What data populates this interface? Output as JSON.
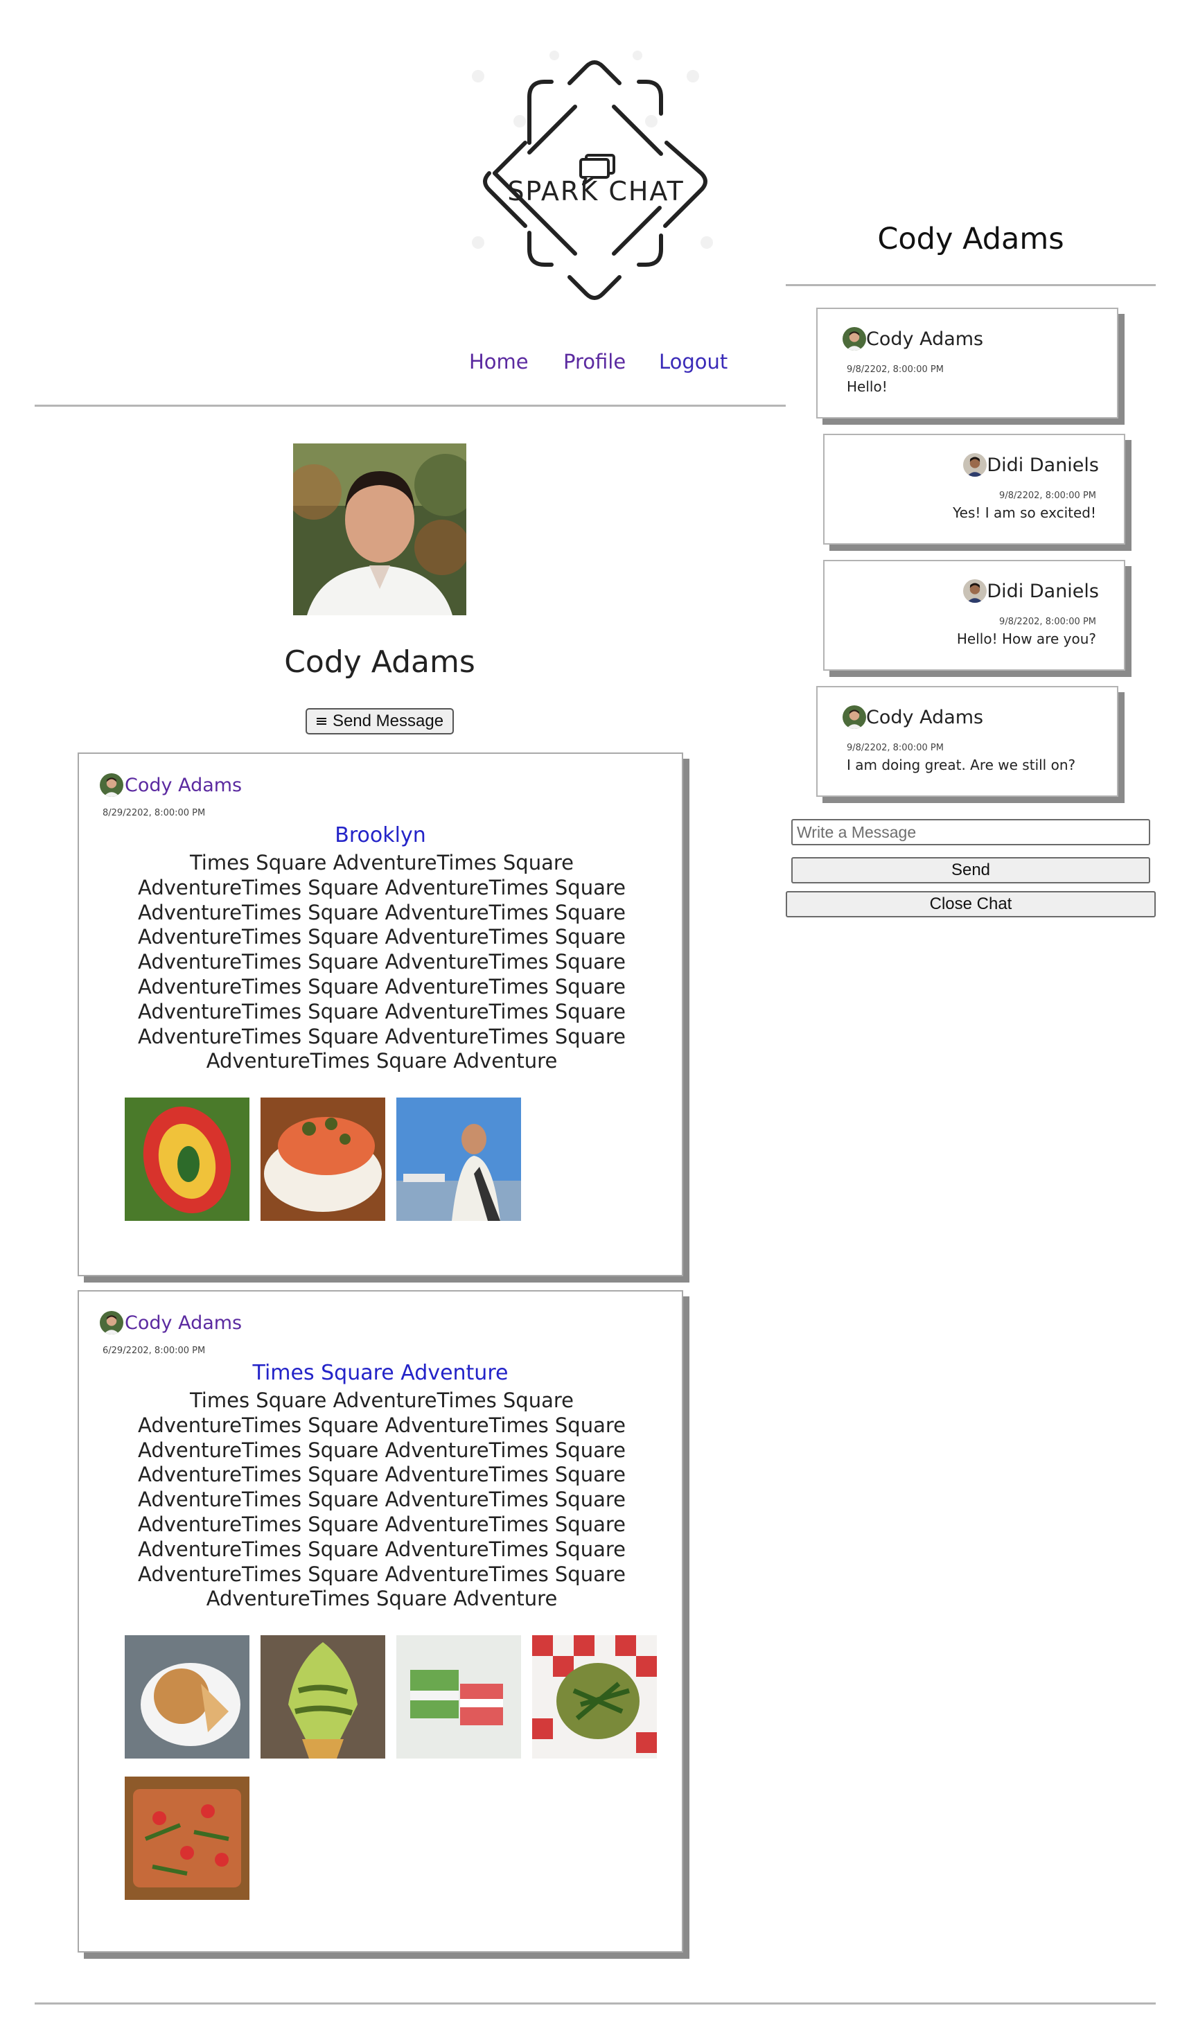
{
  "brand": {
    "name": "SPARK CHAT",
    "logo_icon": "chat-bubbles-icon"
  },
  "nav": {
    "home": "Home",
    "profile": "Profile",
    "logout": "Logout"
  },
  "profile": {
    "name": "Cody Adams",
    "send_message_label": "Send Message",
    "send_message_icon": "menu-lines-icon"
  },
  "posts": [
    {
      "author": "Cody Adams",
      "date": "8/29/2202, 8:00:00 PM",
      "title": "Brooklyn",
      "body": "Times Square AdventureTimes Square AdventureTimes Square AdventureTimes Square AdventureTimes Square AdventureTimes Square AdventureTimes Square AdventureTimes Square AdventureTimes Square AdventureTimes Square AdventureTimes Square AdventureTimes Square AdventureTimes Square AdventureTimes Square AdventureTimes Square AdventureTimes Square AdventureTimes Square Adventure",
      "images": [
        "tulip-photo",
        "smoked-salmon-bagel-photo",
        "woman-at-harbor-photo"
      ]
    },
    {
      "author": "Cody Adams",
      "date": "6/29/2202, 8:00:00 PM",
      "title": "Times Square Adventure",
      "body": "Times Square AdventureTimes Square AdventureTimes Square AdventureTimes Square AdventureTimes Square AdventureTimes Square AdventureTimes Square AdventureTimes Square AdventureTimes Square AdventureTimes Square AdventureTimes Square AdventureTimes Square AdventureTimes Square AdventureTimes Square AdventureTimes Square AdventureTimes Square AdventureTimes Square Adventure",
      "images": [
        "mooncake-photo",
        "green-soft-serve-photo",
        "layered-jelly-cubes-photo",
        "green-beans-photo",
        "vegetable-pizza-photo"
      ]
    }
  ],
  "chat": {
    "title": "Cody Adams",
    "messages": [
      {
        "name": "Cody Adams",
        "date": "9/8/2202, 8:00:00 PM",
        "text": "Hello!",
        "side": "left"
      },
      {
        "name": "Didi Daniels",
        "date": "9/8/2202, 8:00:00 PM",
        "text": "Yes! I am so excited!",
        "side": "right"
      },
      {
        "name": "Didi Daniels",
        "date": "9/8/2202, 8:00:00 PM",
        "text": "Hello! How are you?",
        "side": "right"
      },
      {
        "name": "Cody Adams",
        "date": "9/8/2202, 8:00:00 PM",
        "text": "I am doing great. Are we still on?",
        "side": "left"
      }
    ],
    "input_placeholder": "Write a Message",
    "send_label": "Send",
    "close_label": "Close Chat"
  },
  "colors": {
    "link_purple": "#5b2aa0",
    "link_blue": "#2323c8",
    "rule_gray": "#b5b5b5",
    "shadow_gray": "#8a8a8a"
  }
}
